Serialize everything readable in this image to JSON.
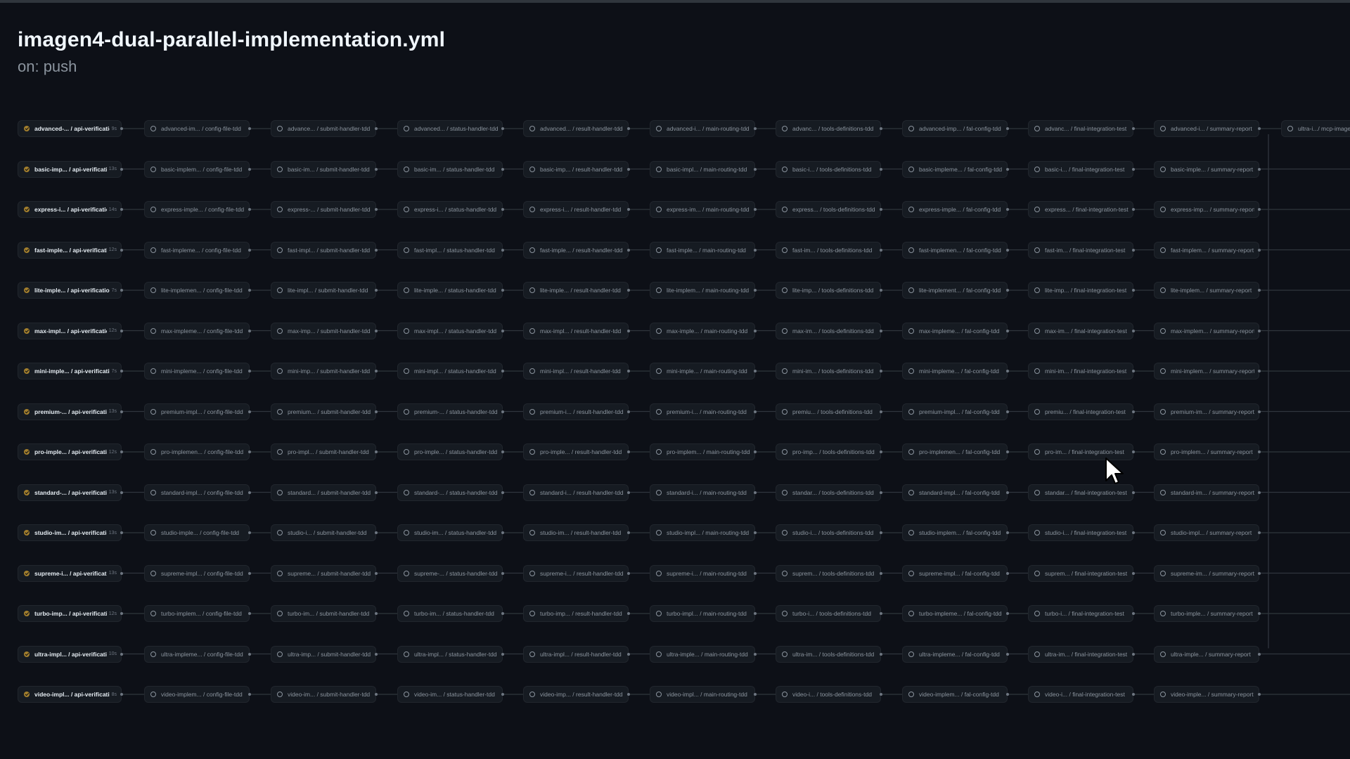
{
  "workflow": {
    "title": "imagen4-dual-parallel-implementation.yml",
    "trigger": "on: push"
  },
  "overflow_job": "ultra-i.../ mcp-images",
  "rows": [
    {
      "jobs": [
        "advanced-... / api-verification",
        "advanced-im... / config-file-tdd",
        "advance... / submit-handler-tdd",
        "advanced... / status-handler-tdd",
        "advanced... / result-handler-tdd",
        "advanced-i... / main-routing-tdd",
        "advanc... / tools-definitions-tdd",
        "advanced-imp... / fal-config-tdd",
        "advanc... / final-integration-test",
        "advanced-i... / summary-report"
      ],
      "duration": "9s"
    },
    {
      "jobs": [
        "basic-imp... / api-verification",
        "basic-implem... / config-file-tdd",
        "basic-im... / submit-handler-tdd",
        "basic-im... / status-handler-tdd",
        "basic-imp... / result-handler-tdd",
        "basic-impl... / main-routing-tdd",
        "basic-i... / tools-definitions-tdd",
        "basic-impleme... / fal-config-tdd",
        "basic-i... / final-integration-test",
        "basic-imple... / summary-report"
      ],
      "duration": "13s"
    },
    {
      "jobs": [
        "express-i... / api-verification",
        "express-imple... / config-file-tdd",
        "express-... / submit-handler-tdd",
        "express-i... / status-handler-tdd",
        "express-i... / result-handler-tdd",
        "express-im... / main-routing-tdd",
        "express... / tools-definitions-tdd",
        "express-imple... / fal-config-tdd",
        "express... / final-integration-test",
        "express-imp... / summary-report"
      ],
      "duration": "14s"
    },
    {
      "jobs": [
        "fast-imple... / api-verification",
        "fast-impleme... / config-file-tdd",
        "fast-impl... / submit-handler-tdd",
        "fast-impl... / status-handler-tdd",
        "fast-imple... / result-handler-tdd",
        "fast-imple... / main-routing-tdd",
        "fast-im... / tools-definitions-tdd",
        "fast-implemen... / fal-config-tdd",
        "fast-im... / final-integration-test",
        "fast-implem... / summary-report"
      ],
      "duration": "12s"
    },
    {
      "jobs": [
        "lite-imple... / api-verification",
        "lite-implemen... / config-file-tdd",
        "lite-impl... / submit-handler-tdd",
        "lite-imple... / status-handler-tdd",
        "lite-imple... / result-handler-tdd",
        "lite-implem... / main-routing-tdd",
        "lite-imp... / tools-definitions-tdd",
        "lite-implement... / fal-config-tdd",
        "lite-imp... / final-integration-test",
        "lite-implem... / summary-report"
      ],
      "duration": "7s"
    },
    {
      "jobs": [
        "max-impl... / api-verification",
        "max-impleme... / config-file-tdd",
        "max-imp... / submit-handler-tdd",
        "max-impl... / status-handler-tdd",
        "max-impl... / result-handler-tdd",
        "max-imple... / main-routing-tdd",
        "max-im... / tools-definitions-tdd",
        "max-impleme... / fal-config-tdd",
        "max-im... / final-integration-test",
        "max-implem... / summary-report"
      ],
      "duration": "12s"
    },
    {
      "jobs": [
        "mini-imple... / api-verification",
        "mini-impleme... / config-file-tdd",
        "mini-imp... / submit-handler-tdd",
        "mini-impl... / status-handler-tdd",
        "mini-impl... / result-handler-tdd",
        "mini-imple... / main-routing-tdd",
        "mini-im... / tools-definitions-tdd",
        "mini-impleme... / fal-config-tdd",
        "mini-im... / final-integration-test",
        "mini-implem... / summary-report"
      ],
      "duration": "7s"
    },
    {
      "jobs": [
        "premium-... / api-verification",
        "premium-impl... / config-file-tdd",
        "premium... / submit-handler-tdd",
        "premium-... / status-handler-tdd",
        "premium-i... / result-handler-tdd",
        "premium-i... / main-routing-tdd",
        "premiu... / tools-definitions-tdd",
        "premium-impl... / fal-config-tdd",
        "premiu... / final-integration-test",
        "premium-im... / summary-report"
      ],
      "duration": "13s"
    },
    {
      "jobs": [
        "pro-imple... / api-verification",
        "pro-implemen... / config-file-tdd",
        "pro-impl... / submit-handler-tdd",
        "pro-imple... / status-handler-tdd",
        "pro-imple... / result-handler-tdd",
        "pro-implem... / main-routing-tdd",
        "pro-imp... / tools-definitions-tdd",
        "pro-implemen... / fal-config-tdd",
        "pro-im... / final-integration-test",
        "pro-implem... / summary-report"
      ],
      "duration": "12s"
    },
    {
      "jobs": [
        "standard-... / api-verification",
        "standard-impl... / config-file-tdd",
        "standard... / submit-handler-tdd",
        "standard-... / status-handler-tdd",
        "standard-i... / result-handler-tdd",
        "standard-i... / main-routing-tdd",
        "standar... / tools-definitions-tdd",
        "standard-impl... / fal-config-tdd",
        "standar... / final-integration-test",
        "standard-im... / summary-report"
      ],
      "duration": "13s"
    },
    {
      "jobs": [
        "studio-im... / api-verification",
        "studio-imple... / config-file-tdd",
        "studio-i... / submit-handler-tdd",
        "studio-im... / status-handler-tdd",
        "studio-im... / result-handler-tdd",
        "studio-impl... / main-routing-tdd",
        "studio-i... / tools-definitions-tdd",
        "studio-implem... / fal-config-tdd",
        "studio-i... / final-integration-test",
        "studio-impl... / summary-report"
      ],
      "duration": "13s"
    },
    {
      "jobs": [
        "supreme-i... / api-verification",
        "supreme-impl... / config-file-tdd",
        "supreme... / submit-handler-tdd",
        "supreme-... / status-handler-tdd",
        "supreme-i... / result-handler-tdd",
        "supreme-i... / main-routing-tdd",
        "suprem... / tools-definitions-tdd",
        "supreme-impl... / fal-config-tdd",
        "suprem... / final-integration-test",
        "supreme-im... / summary-report"
      ],
      "duration": "13s"
    },
    {
      "jobs": [
        "turbo-imp... / api-verification",
        "turbo-implem... / config-file-tdd",
        "turbo-im... / submit-handler-tdd",
        "turbo-im... / status-handler-tdd",
        "turbo-imp... / result-handler-tdd",
        "turbo-impl... / main-routing-tdd",
        "turbo-i... / tools-definitions-tdd",
        "turbo-impleme... / fal-config-tdd",
        "turbo-i... / final-integration-test",
        "turbo-imple... / summary-report"
      ],
      "duration": "12s"
    },
    {
      "jobs": [
        "ultra-impl... / api-verification",
        "ultra-impleme... / config-file-tdd",
        "ultra-imp... / submit-handler-tdd",
        "ultra-impl... / status-handler-tdd",
        "ultra-impl... / result-handler-tdd",
        "ultra-imple... / main-routing-tdd",
        "ultra-im... / tools-definitions-tdd",
        "ultra-impleme... / fal-config-tdd",
        "ultra-im... / final-integration-test",
        "ultra-imple... / summary-report"
      ],
      "duration": "10s"
    },
    {
      "jobs": [
        "video-impl... / api-verification",
        "video-implem... / config-file-tdd",
        "video-im... / submit-handler-tdd",
        "video-im... / status-handler-tdd",
        "video-imp... / result-handler-tdd",
        "video-impl... / main-routing-tdd",
        "video-i... / tools-definitions-tdd",
        "video-implem... / fal-config-tdd",
        "video-i... / final-integration-test",
        "video-imple... / summary-report"
      ],
      "duration": "8s"
    }
  ],
  "colors": {
    "background": "#0d1017",
    "node_bg": "#161b22",
    "node_border": "#21262d",
    "connector": "#30363d",
    "success": "#a37f2d"
  }
}
